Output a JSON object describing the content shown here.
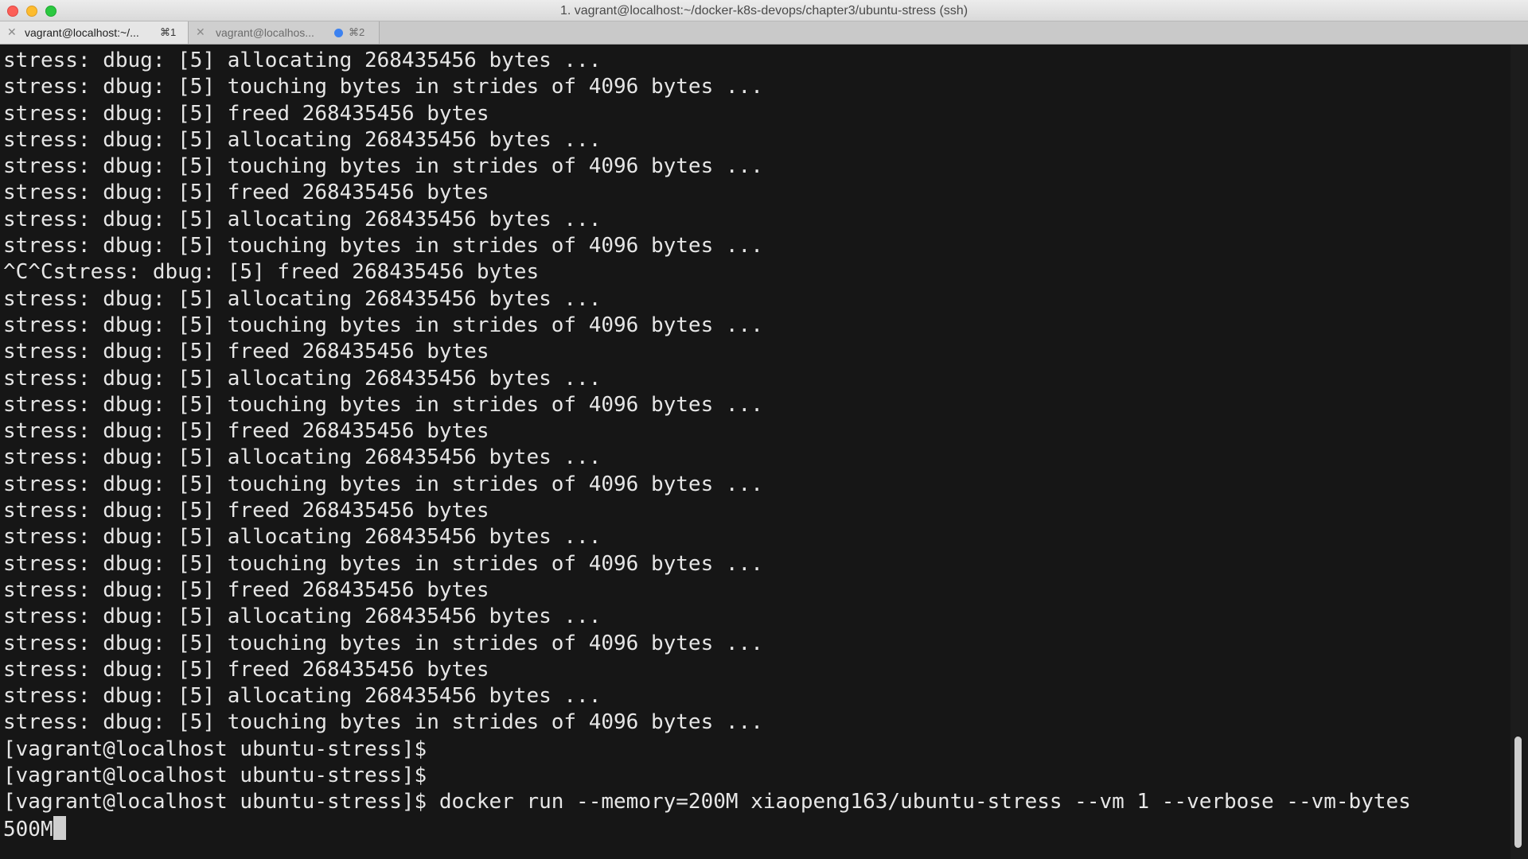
{
  "window": {
    "title": "1. vagrant@localhost:~/docker-k8s-devops/chapter3/ubuntu-stress (ssh)"
  },
  "tabs": [
    {
      "title": "vagrant@localhost:~/...",
      "shortcut": "⌘1",
      "close": "✕"
    },
    {
      "title": "vagrant@localhos...",
      "shortcut": "⌘2",
      "close": "✕"
    }
  ],
  "terminal": {
    "lines": [
      "stress: dbug: [5] allocating 268435456 bytes ...",
      "stress: dbug: [5] touching bytes in strides of 4096 bytes ...",
      "stress: dbug: [5] freed 268435456 bytes",
      "stress: dbug: [5] allocating 268435456 bytes ...",
      "stress: dbug: [5] touching bytes in strides of 4096 bytes ...",
      "stress: dbug: [5] freed 268435456 bytes",
      "stress: dbug: [5] allocating 268435456 bytes ...",
      "stress: dbug: [5] touching bytes in strides of 4096 bytes ...",
      "^C^Cstress: dbug: [5] freed 268435456 bytes",
      "stress: dbug: [5] allocating 268435456 bytes ...",
      "stress: dbug: [5] touching bytes in strides of 4096 bytes ...",
      "stress: dbug: [5] freed 268435456 bytes",
      "stress: dbug: [5] allocating 268435456 bytes ...",
      "stress: dbug: [5] touching bytes in strides of 4096 bytes ...",
      "stress: dbug: [5] freed 268435456 bytes",
      "stress: dbug: [5] allocating 268435456 bytes ...",
      "stress: dbug: [5] touching bytes in strides of 4096 bytes ...",
      "stress: dbug: [5] freed 268435456 bytes",
      "stress: dbug: [5] allocating 268435456 bytes ...",
      "stress: dbug: [5] touching bytes in strides of 4096 bytes ...",
      "stress: dbug: [5] freed 268435456 bytes",
      "stress: dbug: [5] allocating 268435456 bytes ...",
      "stress: dbug: [5] touching bytes in strides of 4096 bytes ...",
      "stress: dbug: [5] freed 268435456 bytes",
      "stress: dbug: [5] allocating 268435456 bytes ...",
      "stress: dbug: [5] touching bytes in strides of 4096 bytes ...",
      "[vagrant@localhost ubuntu-stress]$",
      "[vagrant@localhost ubuntu-stress]$",
      "[vagrant@localhost ubuntu-stress]$ docker run --memory=200M xiaopeng163/ubuntu-stress --vm 1 --verbose --vm-bytes"
    ],
    "current_input": "500M"
  }
}
